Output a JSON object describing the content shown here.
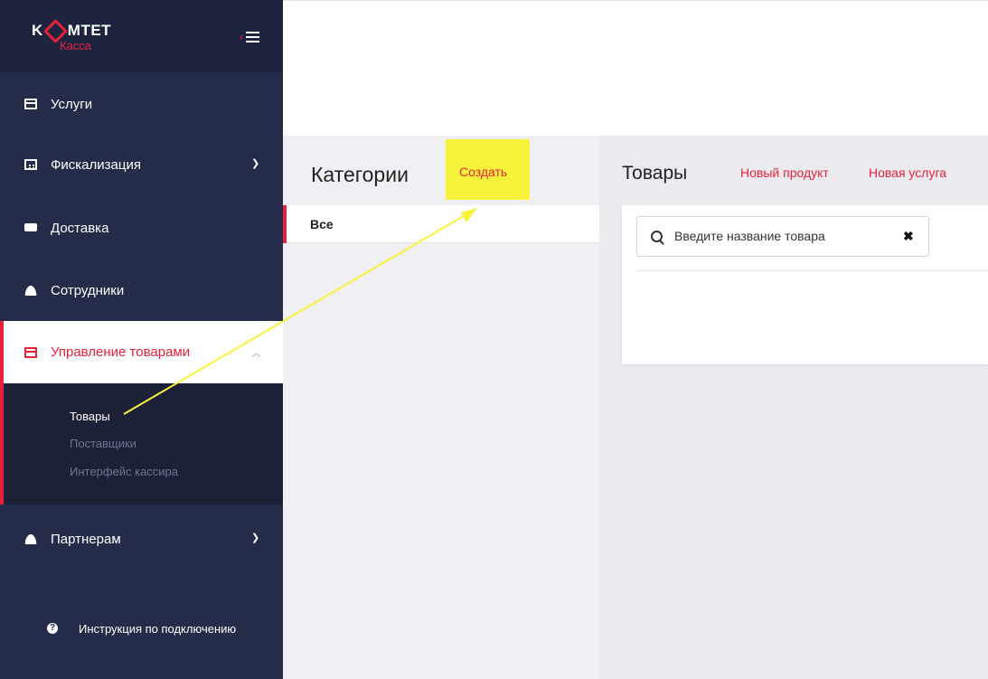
{
  "sidebar": {
    "logo": {
      "word": "KOMTET",
      "sub": "Касса"
    },
    "items": [
      {
        "label": "Услуги",
        "icon": "card-icon"
      },
      {
        "label": "Фискализация",
        "icon": "calculator-icon"
      },
      {
        "label": "Доставка",
        "icon": "truck-icon"
      },
      {
        "label": "Сотрудники",
        "icon": "users-icon"
      },
      {
        "label": "Управление товарами",
        "icon": "card-icon"
      },
      {
        "label": "Партнерам",
        "icon": "users-icon"
      }
    ],
    "submenu": [
      "Товары",
      "Поставщики",
      "Интерфейс кассира"
    ],
    "help": "Инструкция по подключению"
  },
  "categories": {
    "title": "Категории",
    "create": "Создать",
    "rows": [
      "Все"
    ]
  },
  "goods": {
    "title": "Товары",
    "new_product": "Новый продукт",
    "new_service": "Новая услуга",
    "search_placeholder": "Введите название товара"
  },
  "colors": {
    "accent": "#e8203a",
    "sidebar": "#252c4a",
    "highlight": "#f7f33a",
    "arrow": "#f7f33a"
  }
}
